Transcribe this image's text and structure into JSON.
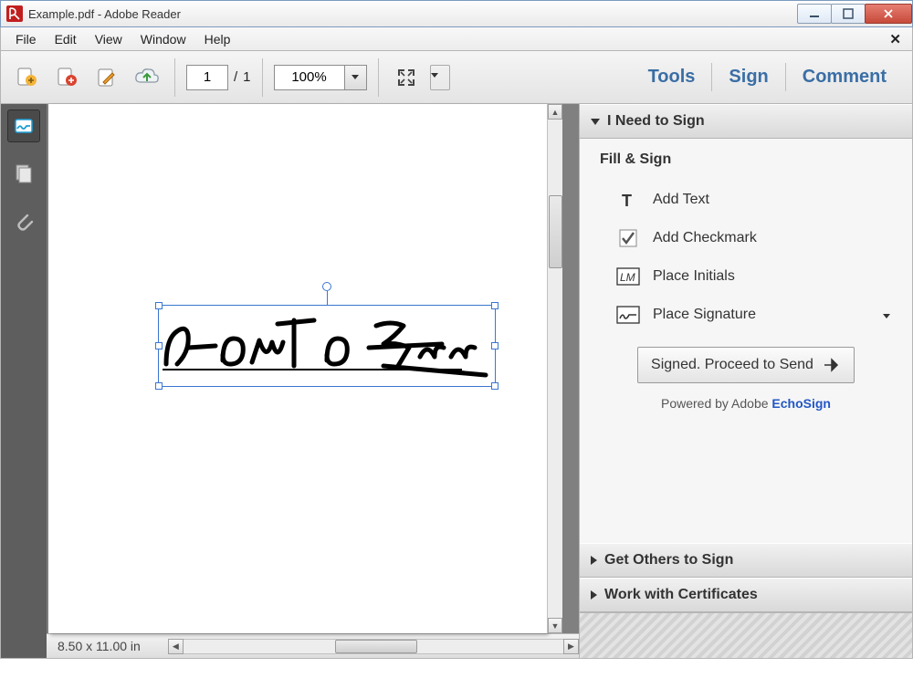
{
  "window": {
    "title": "Example.pdf - Adobe Reader"
  },
  "menu": {
    "items": [
      "File",
      "Edit",
      "View",
      "Window",
      "Help"
    ]
  },
  "toolbar": {
    "page_current": "1",
    "page_sep": "/",
    "page_total": "1",
    "zoom": "100%",
    "tabs": {
      "tools": "Tools",
      "sign": "Sign",
      "comment": "Comment"
    }
  },
  "status": {
    "page_size": "8.50 x 11.00 in"
  },
  "signpanel": {
    "header_sign": "I Need to Sign",
    "fill_sign": "Fill & Sign",
    "add_text": "Add Text",
    "add_check": "Add Checkmark",
    "place_initials": "Place Initials",
    "place_signature": "Place Signature",
    "proceed": "Signed. Proceed to Send",
    "powered": "Powered by Adobe",
    "echosign": "EchoSign",
    "header_others": "Get Others to Sign",
    "header_certs": "Work with Certificates"
  },
  "document": {
    "signature_text": "How-To Geek"
  }
}
